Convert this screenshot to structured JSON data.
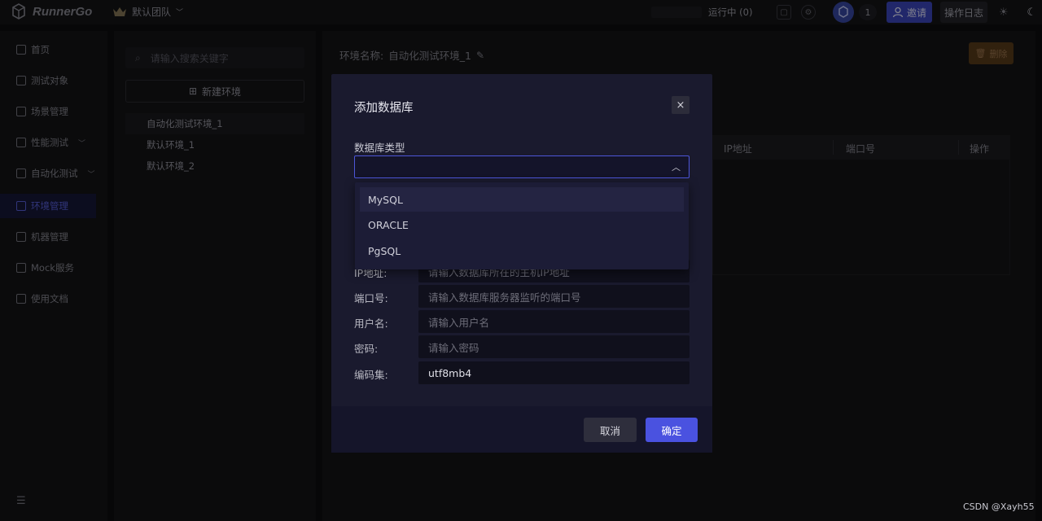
{
  "topbar": {
    "logo_text": "RunnerGo",
    "team_name": "默认团队",
    "running_label": "运行中 (0)",
    "member_count": "1",
    "invite_label": "邀请",
    "op_log_label": "操作日志"
  },
  "sidebar": {
    "items": [
      {
        "label": "首页"
      },
      {
        "label": "测试对象"
      },
      {
        "label": "场景管理"
      },
      {
        "label": "性能测试"
      },
      {
        "label": "自动化测试"
      },
      {
        "label": "环境管理"
      },
      {
        "label": "机器管理"
      },
      {
        "label": "Mock服务"
      },
      {
        "label": "使用文档"
      }
    ]
  },
  "env_panel": {
    "search_placeholder": "请输入搜索关键字",
    "new_env_label": "新建环境",
    "envs": [
      {
        "label": "自动化测试环境_1"
      },
      {
        "label": "默认环境_1"
      },
      {
        "label": "默认环境_2"
      }
    ]
  },
  "main": {
    "env_name_label": "环境名称:",
    "env_name_value": "自动化测试环境_1",
    "delete_label": "删除",
    "table_headers": [
      "IP地址",
      "端口号",
      "操作"
    ]
  },
  "modal": {
    "title": "添加数据库",
    "close_glyph": "×",
    "db_type_label": "数据库类型",
    "db_options": [
      "MySQL",
      "ORACLE",
      "PgSQL"
    ],
    "fields": [
      {
        "label": "IP地址:",
        "placeholder": "请输入数据库所在的主机IP地址",
        "value": ""
      },
      {
        "label": "端口号:",
        "placeholder": "请输入数据库服务器监听的端口号",
        "value": ""
      },
      {
        "label": "用户名:",
        "placeholder": "请输入用户名",
        "value": ""
      },
      {
        "label": "密码:",
        "placeholder": "请输入密码",
        "value": ""
      },
      {
        "label": "编码集:",
        "placeholder": "",
        "value": "utf8mb4"
      }
    ],
    "cancel_label": "取消",
    "ok_label": "确定"
  },
  "watermark": "CSDN @Xayh55",
  "colors": {
    "accent": "#4a52e0",
    "background": "#0e0e10",
    "modal_bg": "#1a1a2e",
    "delete_btn": "#5a3c1a"
  }
}
